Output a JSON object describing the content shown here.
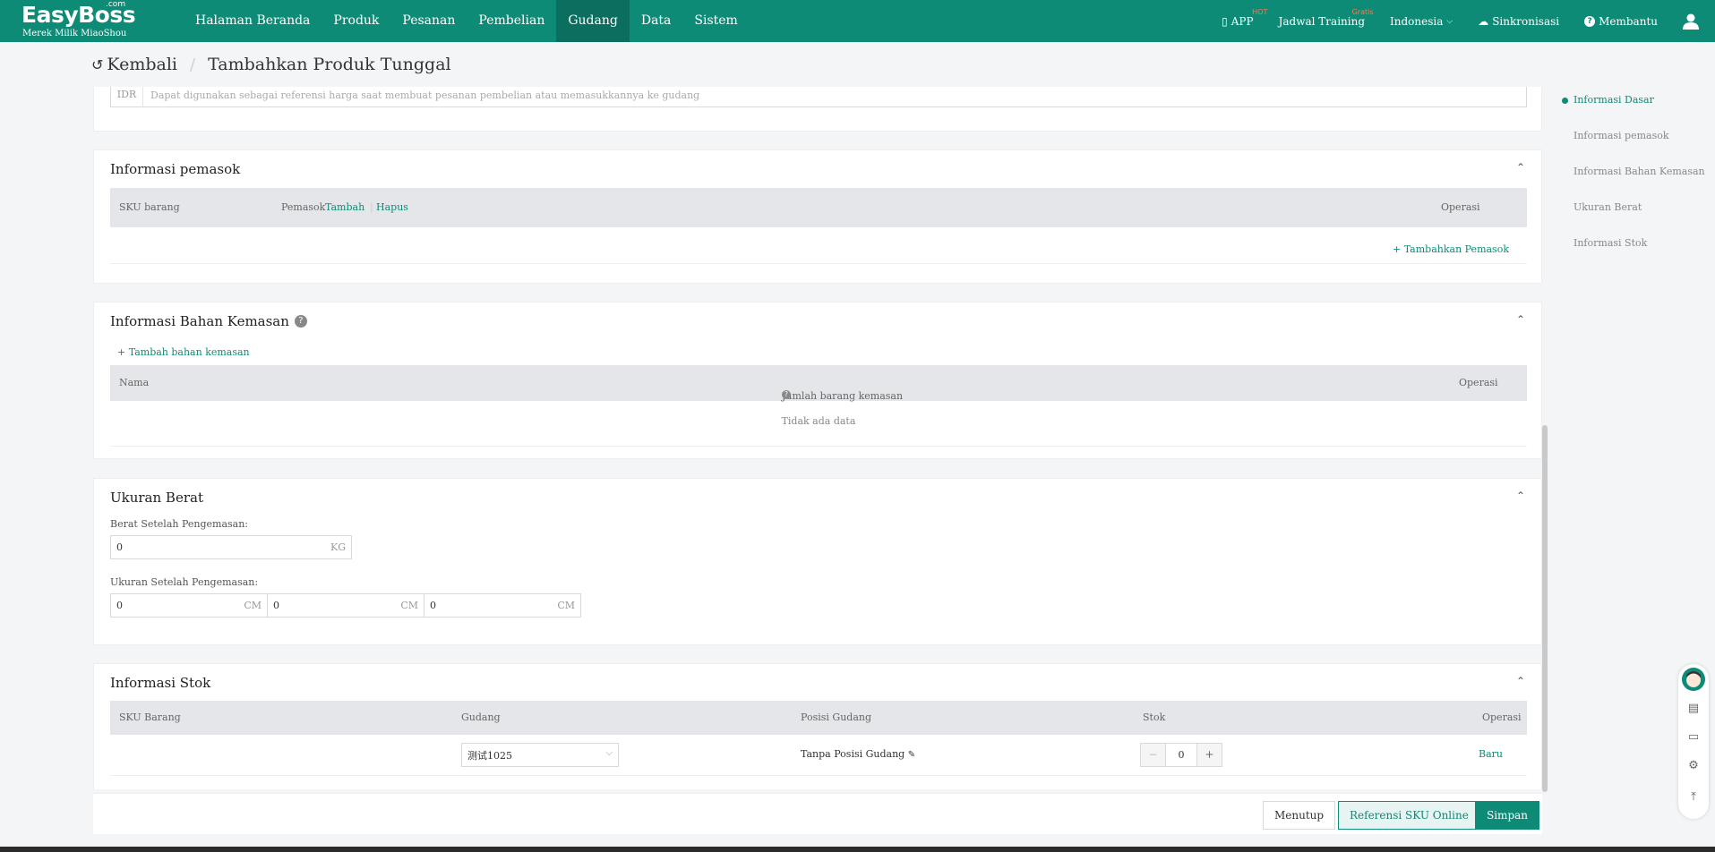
{
  "app": {
    "brand": "EasyBoss",
    "brand_com": ".com",
    "brand_sub": "Merek Milik MiaoShou"
  },
  "nav": {
    "items": [
      {
        "label": "Halaman Beranda"
      },
      {
        "label": "Produk"
      },
      {
        "label": "Pesanan"
      },
      {
        "label": "Pembelian"
      },
      {
        "label": "Gudang"
      },
      {
        "label": "Data"
      },
      {
        "label": "Sistem"
      }
    ],
    "active": "Gudang"
  },
  "topright": {
    "app": "APP",
    "app_badge": "HOT",
    "training": "Jadwal Training",
    "training_badge": "Gratis",
    "language": "Indonesia",
    "sync": "Sinkronisasi",
    "help": "Membantu"
  },
  "header": {
    "back": "Kembali",
    "title": "Tambahkan Produk Tunggal"
  },
  "price": {
    "prefix": "IDR",
    "placeholder": "Dapat digunakan sebagai referensi harga saat membuat pesanan pembelian atau memasukkannya ke gudang"
  },
  "supplier": {
    "title": "Informasi pemasok",
    "col_sku": "SKU barang",
    "col_supplier": "Pemasok",
    "add": "Tambah",
    "delete": "Hapus",
    "col_op": "Operasi",
    "add_supplier": "Tambahkan Pemasok"
  },
  "packaging": {
    "title": "Informasi Bahan Kemasan",
    "add": "Tambah bahan kemasan",
    "col_name": "Nama",
    "col_qty": "Jumlah barang kemasan",
    "col_op": "Operasi",
    "empty": "Tidak ada data"
  },
  "weight": {
    "title": "Ukuran Berat",
    "weight_label": "Berat Setelah Pengemasan:",
    "weight_value": "0",
    "weight_unit": "KG",
    "size_label": "Ukuran Setelah Pengemasan:",
    "length": "0",
    "width": "0",
    "height": "0",
    "size_unit": "CM"
  },
  "stock": {
    "title": "Informasi Stok",
    "col_sku": "SKU Barang",
    "col_warehouse": "Gudang",
    "col_position": "Posisi Gudang",
    "col_stock": "Stok",
    "col_op": "Operasi",
    "row": {
      "warehouse": "测试1025",
      "position": "Tanpa Posisi Gudang",
      "stock": "0",
      "op": "Baru"
    }
  },
  "anchors": [
    {
      "label": "Informasi Dasar"
    },
    {
      "label": "Informasi pemasok"
    },
    {
      "label": "Informasi Bahan Kemasan"
    },
    {
      "label": "Ukuran Berat"
    },
    {
      "label": "Informasi Stok"
    }
  ],
  "footer": {
    "close": "Menutup",
    "ref": "Referensi SKU Online",
    "save": "Simpan"
  },
  "colors": {
    "primary": "#0d8b76",
    "nav_active": "#0b6e5e"
  }
}
